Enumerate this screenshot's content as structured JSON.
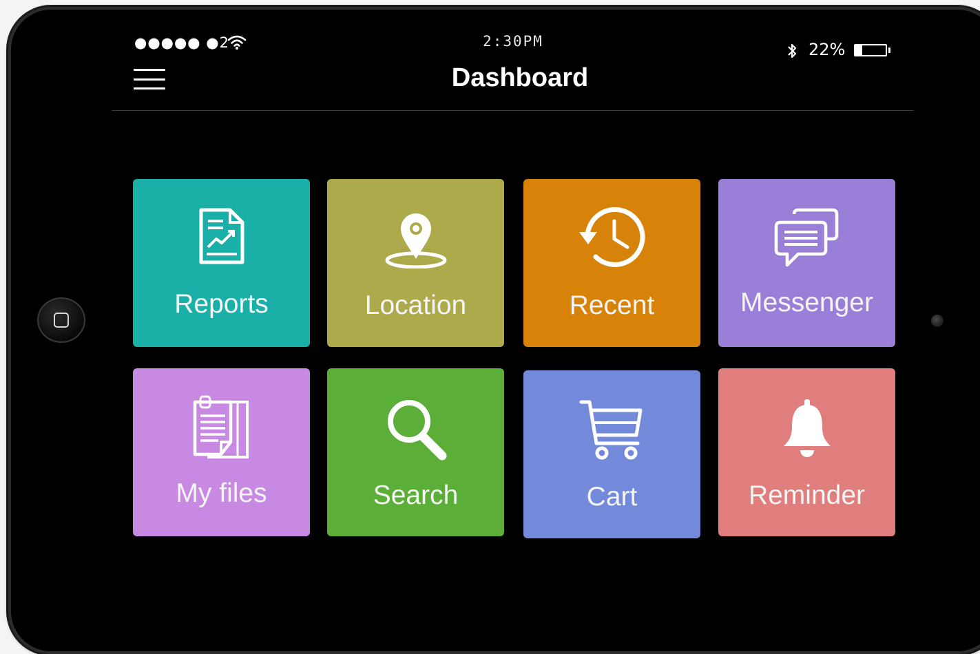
{
  "status_bar": {
    "signal": "●●●●● ●2",
    "time": "2:30PM",
    "battery_percent": "22%",
    "battery_level": 0.22
  },
  "header": {
    "title": "Dashboard"
  },
  "tiles": [
    {
      "label": "Reports",
      "icon": "reports-chart-icon",
      "color": "#1ab0a8"
    },
    {
      "label": "Location",
      "icon": "location-pin-icon",
      "color": "#adaa4c"
    },
    {
      "label": "Recent",
      "icon": "history-clock-icon",
      "color": "#d78309"
    },
    {
      "label": "Messenger",
      "icon": "chat-bubbles-icon",
      "color": "#9a7fd9"
    },
    {
      "label": "My files",
      "icon": "documents-icon",
      "color": "#c789e2"
    },
    {
      "label": "Search",
      "icon": "search-icon",
      "color": "#5bae37"
    },
    {
      "label": "Cart",
      "icon": "cart-icon",
      "color": "#7389d9"
    },
    {
      "label": "Reminder",
      "icon": "bell-icon",
      "color": "#e07e7e"
    }
  ]
}
